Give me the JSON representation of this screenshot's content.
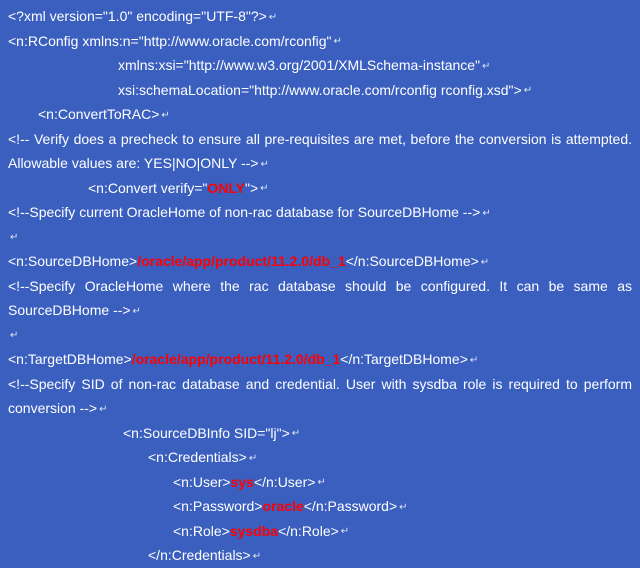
{
  "lines": {
    "l1": "<?xml version=\"1.0\" encoding=\"UTF-8\"?>",
    "l2": "<n:RConfig xmlns:n=\"http://www.oracle.com/rconfig\"",
    "l3": "xmlns:xsi=\"http://www.w3.org/2001/XMLSchema-instance\"",
    "l4": "xsi:schemaLocation=\"http://www.oracle.com/rconfig rconfig.xsd\">",
    "l5": "<n:ConvertToRAC>",
    "l6": "<!-- Verify does a precheck to ensure all pre-requisites are met, before the conversion is attempted. Allowable values are: YES|NO|ONLY -->",
    "l7a": "<n:Convert verify=\"",
    "l7b": "ONLY",
    "l7c": "\">",
    "l8": "<!--Specify current OracleHome of non-rac database for SourceDBHome -->",
    "l9a": "<n:SourceDBHome>",
    "l9b": "/oracle/app/product/11.2.0/db_1",
    "l9c": "</n:SourceDBHome>",
    "l10": "<!--Specify OracleHome where the rac database should be configured. It can be same as SourceDBHome -->",
    "l11a": "<n:TargetDBHome>",
    "l11b": "/oracle/app/product/11.2.0/db_1",
    "l11c": "</n:TargetDBHome>",
    "l12": "<!--Specify SID of non-rac database and credential. User with sysdba role is required to perform conversion -->",
    "l13": "<n:SourceDBInfo SID=\"lj\">",
    "l14": "<n:Credentials>",
    "l15a": "<n:User>",
    "l15b": "sys",
    "l15c": "</n:User>",
    "l16a": "<n:Password>",
    "l16b": "oracle",
    "l16c": "</n:Password>",
    "l17a": "<n:Role>",
    "l17b": "sysdba",
    "l17c": "</n:Role>",
    "l18": "</n:Credentials>"
  },
  "glyph": "↵"
}
